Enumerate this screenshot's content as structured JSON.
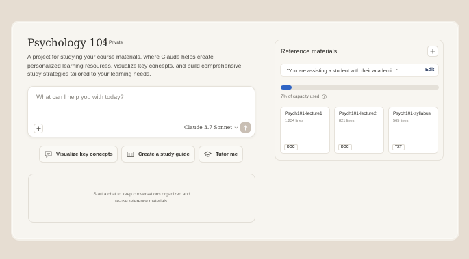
{
  "project": {
    "title": "Psychology 101",
    "visibility": "Private",
    "description": "A project for studying your course materials, where Claude helps create personalized learning resources, visualize key concepts, and build comprehensive study strategies tailored to your learning needs."
  },
  "chat": {
    "placeholder": "What can I help you with today?",
    "model": "Claude 3.7 Sonnet"
  },
  "suggestions": [
    {
      "label": "Visualize key concepts",
      "icon": "chat-bubble-icon"
    },
    {
      "label": "Create a study guide",
      "icon": "document-icon"
    },
    {
      "label": "Tutor me",
      "icon": "graduation-cap-icon"
    }
  ],
  "empty_state": {
    "line1": "Start a chat to keep conversations organized and",
    "line2": "re-use reference materials."
  },
  "reference": {
    "title": "Reference materials",
    "instructions": "\"You are assisting a student with their academi...\"",
    "edit_label": "Edit",
    "capacity_label": "7% of capacity used",
    "capacity_fraction": 0.07,
    "files": [
      {
        "name": "Psych101-lecture1",
        "lines": "1,234 lines",
        "type": "DOC"
      },
      {
        "name": "Psych101-lecture2",
        "lines": "821 lines",
        "type": "DOC"
      },
      {
        "name": "Psych101-syllabus",
        "lines": "565 lines",
        "type": "TXT"
      }
    ]
  },
  "colors": {
    "background": "#e6ddd2",
    "panel": "#f7f5f0",
    "accent": "#2f64c4",
    "send_button": "#c9bfb4"
  }
}
